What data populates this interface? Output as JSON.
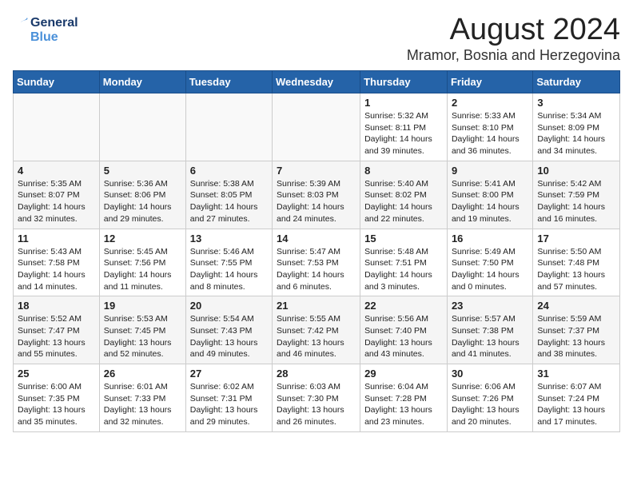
{
  "header": {
    "logo_line1": "General",
    "logo_line2": "Blue",
    "month": "August 2024",
    "location": "Mramor, Bosnia and Herzegovina"
  },
  "days_of_week": [
    "Sunday",
    "Monday",
    "Tuesday",
    "Wednesday",
    "Thursday",
    "Friday",
    "Saturday"
  ],
  "weeks": [
    [
      {
        "day": "",
        "content": ""
      },
      {
        "day": "",
        "content": ""
      },
      {
        "day": "",
        "content": ""
      },
      {
        "day": "",
        "content": ""
      },
      {
        "day": "1",
        "content": "Sunrise: 5:32 AM\nSunset: 8:11 PM\nDaylight: 14 hours\nand 39 minutes."
      },
      {
        "day": "2",
        "content": "Sunrise: 5:33 AM\nSunset: 8:10 PM\nDaylight: 14 hours\nand 36 minutes."
      },
      {
        "day": "3",
        "content": "Sunrise: 5:34 AM\nSunset: 8:09 PM\nDaylight: 14 hours\nand 34 minutes."
      }
    ],
    [
      {
        "day": "4",
        "content": "Sunrise: 5:35 AM\nSunset: 8:07 PM\nDaylight: 14 hours\nand 32 minutes."
      },
      {
        "day": "5",
        "content": "Sunrise: 5:36 AM\nSunset: 8:06 PM\nDaylight: 14 hours\nand 29 minutes."
      },
      {
        "day": "6",
        "content": "Sunrise: 5:38 AM\nSunset: 8:05 PM\nDaylight: 14 hours\nand 27 minutes."
      },
      {
        "day": "7",
        "content": "Sunrise: 5:39 AM\nSunset: 8:03 PM\nDaylight: 14 hours\nand 24 minutes."
      },
      {
        "day": "8",
        "content": "Sunrise: 5:40 AM\nSunset: 8:02 PM\nDaylight: 14 hours\nand 22 minutes."
      },
      {
        "day": "9",
        "content": "Sunrise: 5:41 AM\nSunset: 8:00 PM\nDaylight: 14 hours\nand 19 minutes."
      },
      {
        "day": "10",
        "content": "Sunrise: 5:42 AM\nSunset: 7:59 PM\nDaylight: 14 hours\nand 16 minutes."
      }
    ],
    [
      {
        "day": "11",
        "content": "Sunrise: 5:43 AM\nSunset: 7:58 PM\nDaylight: 14 hours\nand 14 minutes."
      },
      {
        "day": "12",
        "content": "Sunrise: 5:45 AM\nSunset: 7:56 PM\nDaylight: 14 hours\nand 11 minutes."
      },
      {
        "day": "13",
        "content": "Sunrise: 5:46 AM\nSunset: 7:55 PM\nDaylight: 14 hours\nand 8 minutes."
      },
      {
        "day": "14",
        "content": "Sunrise: 5:47 AM\nSunset: 7:53 PM\nDaylight: 14 hours\nand 6 minutes."
      },
      {
        "day": "15",
        "content": "Sunrise: 5:48 AM\nSunset: 7:51 PM\nDaylight: 14 hours\nand 3 minutes."
      },
      {
        "day": "16",
        "content": "Sunrise: 5:49 AM\nSunset: 7:50 PM\nDaylight: 14 hours\nand 0 minutes."
      },
      {
        "day": "17",
        "content": "Sunrise: 5:50 AM\nSunset: 7:48 PM\nDaylight: 13 hours\nand 57 minutes."
      }
    ],
    [
      {
        "day": "18",
        "content": "Sunrise: 5:52 AM\nSunset: 7:47 PM\nDaylight: 13 hours\nand 55 minutes."
      },
      {
        "day": "19",
        "content": "Sunrise: 5:53 AM\nSunset: 7:45 PM\nDaylight: 13 hours\nand 52 minutes."
      },
      {
        "day": "20",
        "content": "Sunrise: 5:54 AM\nSunset: 7:43 PM\nDaylight: 13 hours\nand 49 minutes."
      },
      {
        "day": "21",
        "content": "Sunrise: 5:55 AM\nSunset: 7:42 PM\nDaylight: 13 hours\nand 46 minutes."
      },
      {
        "day": "22",
        "content": "Sunrise: 5:56 AM\nSunset: 7:40 PM\nDaylight: 13 hours\nand 43 minutes."
      },
      {
        "day": "23",
        "content": "Sunrise: 5:57 AM\nSunset: 7:38 PM\nDaylight: 13 hours\nand 41 minutes."
      },
      {
        "day": "24",
        "content": "Sunrise: 5:59 AM\nSunset: 7:37 PM\nDaylight: 13 hours\nand 38 minutes."
      }
    ],
    [
      {
        "day": "25",
        "content": "Sunrise: 6:00 AM\nSunset: 7:35 PM\nDaylight: 13 hours\nand 35 minutes."
      },
      {
        "day": "26",
        "content": "Sunrise: 6:01 AM\nSunset: 7:33 PM\nDaylight: 13 hours\nand 32 minutes."
      },
      {
        "day": "27",
        "content": "Sunrise: 6:02 AM\nSunset: 7:31 PM\nDaylight: 13 hours\nand 29 minutes."
      },
      {
        "day": "28",
        "content": "Sunrise: 6:03 AM\nSunset: 7:30 PM\nDaylight: 13 hours\nand 26 minutes."
      },
      {
        "day": "29",
        "content": "Sunrise: 6:04 AM\nSunset: 7:28 PM\nDaylight: 13 hours\nand 23 minutes."
      },
      {
        "day": "30",
        "content": "Sunrise: 6:06 AM\nSunset: 7:26 PM\nDaylight: 13 hours\nand 20 minutes."
      },
      {
        "day": "31",
        "content": "Sunrise: 6:07 AM\nSunset: 7:24 PM\nDaylight: 13 hours\nand 17 minutes."
      }
    ]
  ]
}
